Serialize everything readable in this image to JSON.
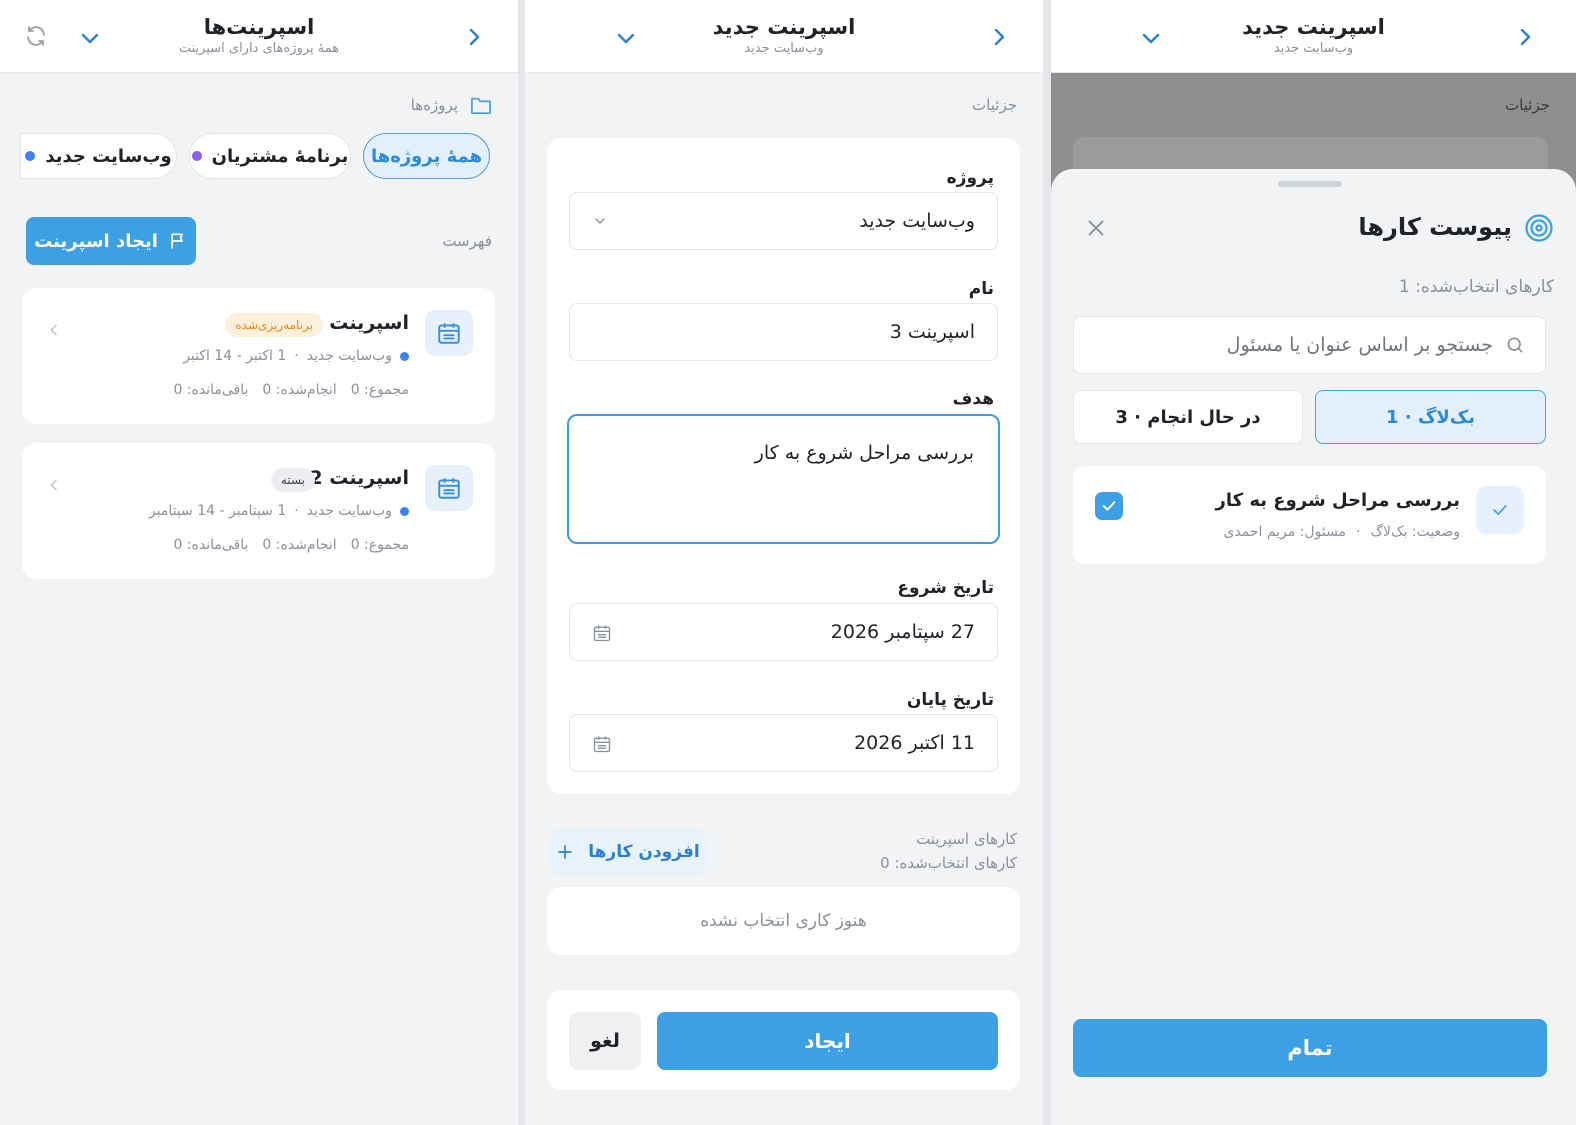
{
  "panel1": {
    "header": {
      "title": "اسپرینت‌ها",
      "subtitle": "همهٔ پروژه‌های دارای اسپرینت"
    },
    "projects_label": "پروژه‌ها",
    "chips": [
      {
        "label": "همهٔ پروژه‌ها",
        "active": true
      },
      {
        "label": "برنامهٔ مشتریان",
        "dot_color": "#8b5cf6"
      },
      {
        "label": "وب‌سایت جدید",
        "dot_color": "#3b82f6"
      }
    ],
    "list_label": "فهرست",
    "create_button": "ایجاد اسپرینت",
    "sprints": [
      {
        "name": "اسپرینت 1",
        "status": "برنامه‌ریزی‌شده",
        "project": "وب‌سایت جدید",
        "dates": "1 اکتبر - 14 اکتبر",
        "total": "مجموع: 0",
        "done": "انجام‌شده: 0",
        "remaining": "باقی‌مانده: 0"
      },
      {
        "name": "اسپرینت 2",
        "status": "بسته",
        "project": "وب‌سایت جدید",
        "dates": "1 سپتامبر - 14 سپتامبر",
        "total": "مجموع: 0",
        "done": "انجام‌شده: 0",
        "remaining": "باقی‌مانده: 0"
      }
    ]
  },
  "panel2": {
    "header": {
      "title": "اسپرینت جدید",
      "subtitle": "وب‌سایت جدید"
    },
    "details_label": "جزئیات",
    "fields": {
      "project": {
        "label": "پروژه",
        "value": "وب‌سایت جدید"
      },
      "name": {
        "label": "نام",
        "value": "اسپرینت 3"
      },
      "goal": {
        "label": "هدف",
        "value": "بررسی مراحل شروع به کار"
      },
      "start": {
        "label": "تاریخ شروع",
        "value": "27 سپتامبر 2026"
      },
      "end": {
        "label": "تاریخ پایان",
        "value": "11 اکتبر 2026"
      }
    },
    "tasks_title": "کارهای اسپرینت",
    "tasks_selected": "کارهای انتخاب‌شده: 0",
    "add_tasks_button": "افزودن کارها",
    "empty_text": "هنوز کاری انتخاب نشده",
    "create_button": "ایجاد",
    "cancel_button": "لغو"
  },
  "panel3": {
    "header": {
      "title": "اسپرینت جدید",
      "subtitle": "وب‌سایت جدید"
    },
    "details_label": "جزئیات",
    "sheet_title": "پیوست کارها",
    "selected_count": "کارهای انتخاب‌شده: 1",
    "search_placeholder": "جستجو بر اساس عنوان یا مسئول",
    "tabs": [
      {
        "label": "بک‌لاگ · 1",
        "active": true
      },
      {
        "label": "در حال انجام · 3",
        "active": false
      }
    ],
    "task": {
      "title": "بررسی مراحل شروع به کار",
      "status": "وضعیت: بک‌لاگ",
      "assignee": "مسئول: مریم احمدی",
      "checked": true
    },
    "done_button": "تمام"
  },
  "colors": {
    "accent": "#3ea0e4",
    "accent_text": "#2c7fd1",
    "planned_badge": "#e8890c",
    "background": "#f2f3f5"
  }
}
